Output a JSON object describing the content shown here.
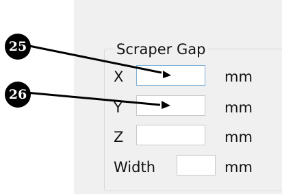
{
  "group": {
    "title": "Scraper Gap"
  },
  "fields": [
    {
      "label": "X",
      "value": "",
      "unit": "mm"
    },
    {
      "label": "Y",
      "value": "",
      "unit": "mm"
    },
    {
      "label": "Z",
      "value": "",
      "unit": "mm"
    },
    {
      "label": "Width",
      "value": "",
      "unit": "mm"
    }
  ],
  "callouts": [
    {
      "number": "25"
    },
    {
      "number": "26"
    }
  ]
}
